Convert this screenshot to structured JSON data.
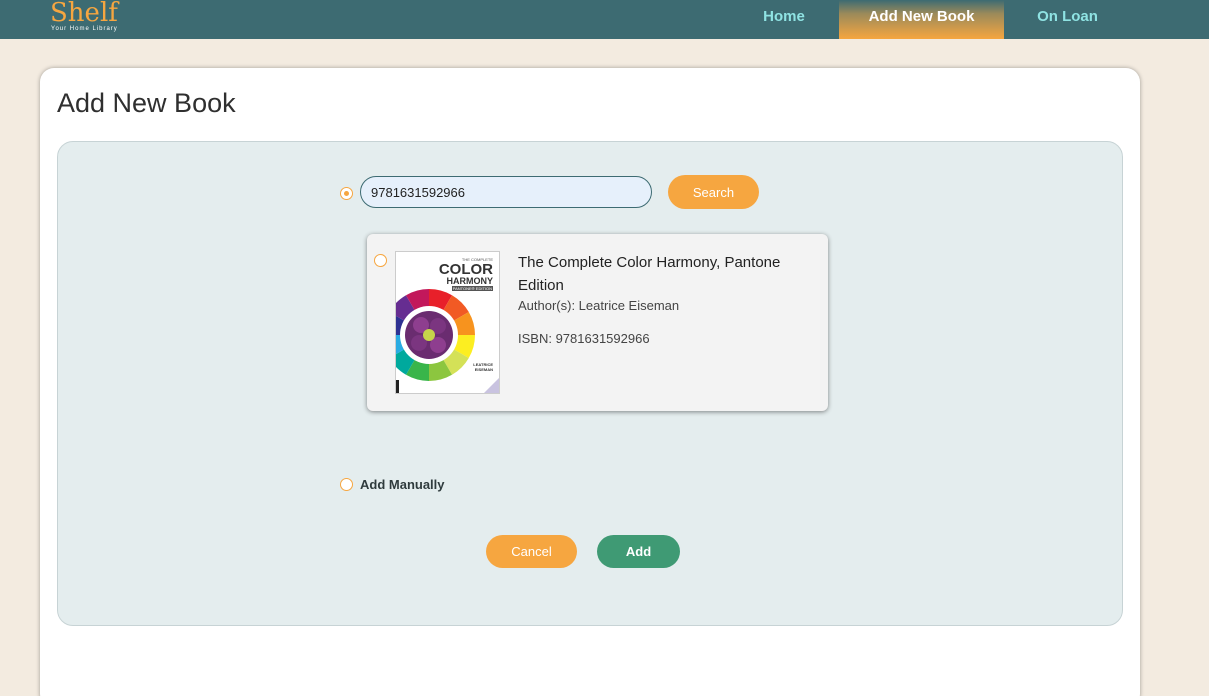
{
  "app": {
    "logo_text": "Shelf",
    "logo_tagline": "Your Home Library"
  },
  "nav": {
    "home": "Home",
    "add_new_book": "Add New Book",
    "on_loan": "On Loan",
    "active": "Add New Book"
  },
  "page": {
    "title": "Add New Book"
  },
  "search": {
    "value": "9781631592966",
    "button_label": "Search",
    "selected": true
  },
  "result": {
    "title": "The Complete Color Harmony, Pantone Edition",
    "authors": "Author(s): Leatrice Eiseman",
    "isbn": "ISBN: 9781631592966",
    "cover": {
      "line1": "THE COMPLETE",
      "line2": "COLOR",
      "line3": "HARMONY",
      "line4": "PANTONE® EDITION",
      "author1": "LEATRICE",
      "author2": "EISEMAN"
    },
    "selected": false
  },
  "manual": {
    "label": "Add Manually",
    "selected": false
  },
  "actions": {
    "cancel": "Cancel",
    "add": "Add"
  },
  "colors": {
    "nav_bg": "#3d6b72",
    "accent_orange": "#f6a640",
    "add_green": "#3f9a74",
    "page_bg": "#f3ebe0",
    "panel_bg": "#e4edee"
  }
}
